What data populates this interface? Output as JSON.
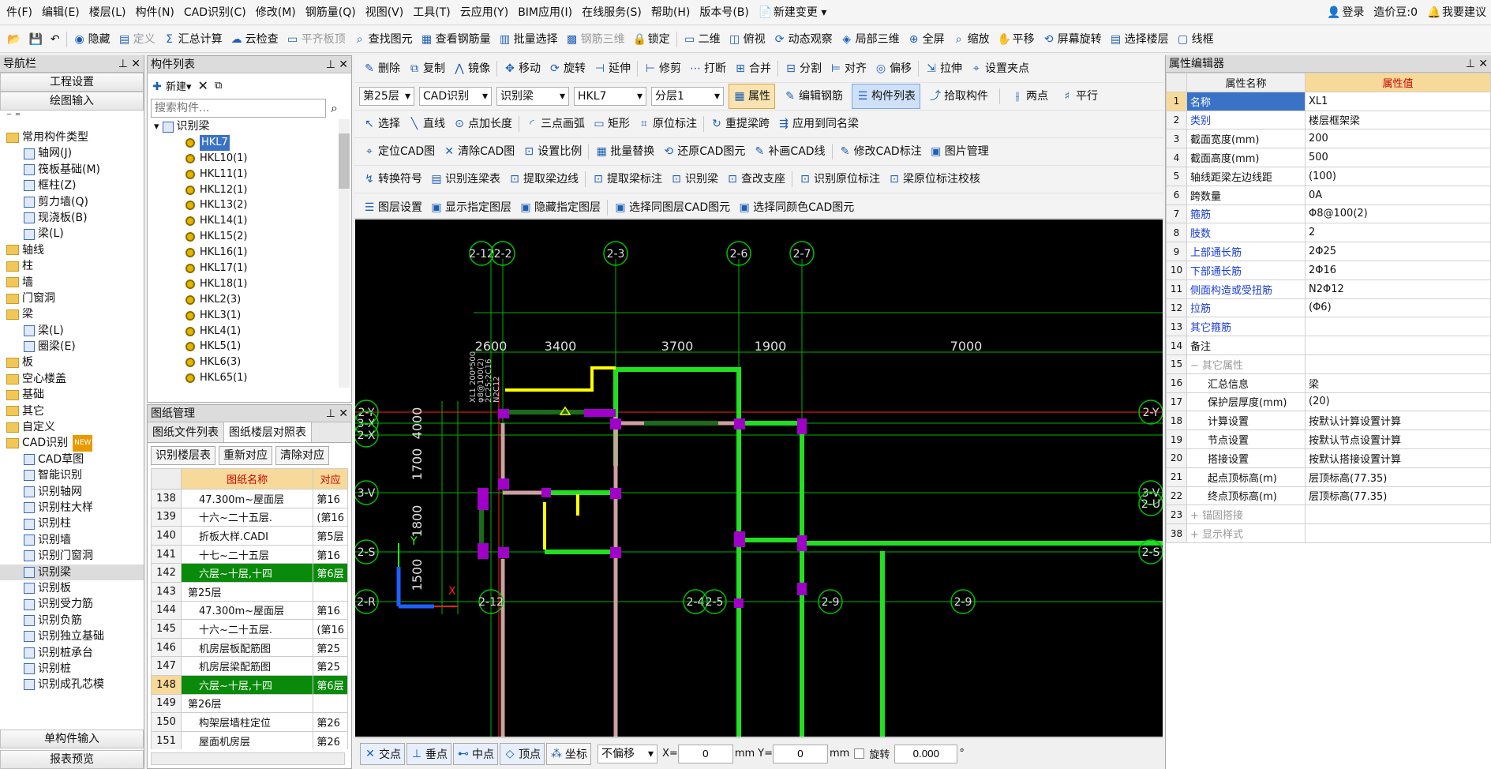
{
  "menubar": {
    "items": [
      "件(F)",
      "编辑(E)",
      "楼层(L)",
      "构件(N)",
      "CAD识别(C)",
      "修改(M)",
      "钢筋量(Q)",
      "视图(V)",
      "工具(T)",
      "云应用(Y)",
      "BIM应用(I)",
      "在线服务(S)",
      "帮助(H)",
      "版本号(B)"
    ],
    "new_change": "新建变更",
    "login": "登录",
    "price_beans": "造价豆:0",
    "suggest": "我要建议"
  },
  "toolbar1": {
    "items": [
      "隐藏",
      "定义",
      "汇总计算",
      "云检查",
      "平齐板顶",
      "查找图元",
      "查看钢筋量",
      "批量选择",
      "钢筋三维",
      "锁定"
    ],
    "view_items": [
      "二维",
      "俯视",
      "动态观察",
      "局部三维",
      "全屏",
      "缩放",
      "平移",
      "屏幕旋转",
      "选择楼层",
      "线框"
    ]
  },
  "nav": {
    "title": "导航栏",
    "btn_project": "工程设置",
    "btn_draw": "绘图输入",
    "btn_single": "单构件输入",
    "btn_report": "报表预览",
    "tree": [
      "常用构件类型",
      "轴网(J)",
      "筏板基础(M)",
      "框柱(Z)",
      "剪力墙(Q)",
      "现浇板(B)",
      "梁(L)",
      "轴线",
      "柱",
      "墙",
      "门窗洞",
      "梁",
      "梁(L)",
      "圈梁(E)",
      "板",
      "空心楼盖",
      "基础",
      "其它",
      "自定义",
      "CAD识别",
      "CAD草图",
      "智能识别",
      "识别轴网",
      "识别柱大样",
      "识别柱",
      "识别墙",
      "识别门窗洞",
      "识别梁",
      "识别板",
      "识别受力筋",
      "识别负筋",
      "识别独立基础",
      "识别桩承台",
      "识别桩",
      "识别成孔芯模"
    ],
    "new_badge": "NEW"
  },
  "components": {
    "title": "构件列表",
    "new": "新建",
    "search_placeholder": "搜索构件...",
    "group": "识别梁",
    "items": [
      "HKL7",
      "HKL10(1)",
      "HKL11(1)",
      "HKL12(1)",
      "HKL13(2)",
      "HKL14(1)",
      "HKL15(2)",
      "HKL16(1)",
      "HKL17(1)",
      "HKL18(1)",
      "HKL2(3)",
      "HKL3(1)",
      "HKL4(1)",
      "HKL5(1)",
      "HKL6(3)",
      "HKL65(1)"
    ]
  },
  "drawings": {
    "title": "图纸管理",
    "tabs": [
      "图纸文件列表",
      "图纸楼层对照表"
    ],
    "buttons": [
      "识别楼层表",
      "重新对应",
      "清除对应"
    ],
    "col_name": "图纸名称",
    "col_map": "对应",
    "rows": [
      [
        "138",
        "47.300m~屋面层",
        "第16"
      ],
      [
        "139",
        "十六~二十五层.",
        "(第16"
      ],
      [
        "140",
        "折板大样.CADI",
        "第5层"
      ],
      [
        "141",
        "十七~二十五层",
        "第16"
      ],
      [
        "142",
        "六层~十层,十四",
        "第6层"
      ],
      [
        "143",
        "第25层",
        ""
      ],
      [
        "144",
        "47.300m~屋面层",
        "第16"
      ],
      [
        "145",
        "十六~二十五层.",
        "(第16"
      ],
      [
        "146",
        "机房层板配筋图",
        "第25"
      ],
      [
        "147",
        "机房层梁配筋图",
        "第25"
      ],
      [
        "148",
        "六层~十层,十四",
        "第6层"
      ],
      [
        "149",
        "第26层",
        ""
      ],
      [
        "150",
        "构架层墙柱定位",
        "第26"
      ],
      [
        "151",
        "屋面机房层",
        "第26"
      ]
    ]
  },
  "ribbon": {
    "r1": [
      "删除",
      "复制",
      "镜像",
      "移动",
      "旋转",
      "延伸",
      "修剪",
      "打断",
      "合并",
      "分割",
      "对齐",
      "偏移",
      "拉伸",
      "设置夹点"
    ],
    "r2": {
      "floor": "第25层",
      "cad": "CAD识别",
      "beam": "识别梁",
      "comp": "HKL7",
      "layer": "分层1",
      "attr": "属性",
      "edit_rebar": "编辑钢筋",
      "comp_list": "构件列表",
      "pick": "拾取构件",
      "two_point": "两点",
      "parallel": "平行"
    },
    "r3": [
      "选择",
      "直线",
      "点加长度",
      "三点画弧",
      "矩形",
      "原位标注",
      "重提梁跨",
      "应用到同名梁"
    ],
    "r4": [
      "定位CAD图",
      "清除CAD图",
      "设置比例",
      "批量替换",
      "还原CAD图元",
      "补画CAD线",
      "修改CAD标注",
      "图片管理"
    ],
    "r5": [
      "转换符号",
      "识别连梁表",
      "提取梁边线",
      "提取梁标注",
      "识别梁",
      "查改支座",
      "识别原位标注",
      "梁原位标注校核"
    ],
    "r6": [
      "图层设置",
      "显示指定图层",
      "隐藏指定图层",
      "选择同图层CAD图元",
      "选择同颜色CAD图元"
    ]
  },
  "canvas": {
    "axes_top": [
      "2-12",
      "2-2",
      "2-3",
      "2-6",
      "2-7"
    ],
    "dims_top": [
      "2600",
      "3400",
      "3700",
      "1900",
      "7000"
    ],
    "axes_left": [
      "2-Y",
      "3-X",
      "2-X",
      "3-V",
      "2-S",
      "2-R"
    ],
    "axes_right": [
      "2-Y",
      "3-V",
      "2-U",
      "2-S"
    ],
    "dims_left": [
      "4000",
      "1700",
      "1800",
      "1500"
    ],
    "axes_bottom": [
      "2-12",
      "2-4",
      "2-5",
      "2-9",
      "2-9"
    ],
    "beam_label": [
      "XL1 200*500",
      "φ8@100(2)",
      "2C25;2C16",
      "N2C12"
    ],
    "ucs_y": "Y",
    "ucs_x": "X"
  },
  "status": {
    "items": [
      "交点",
      "垂点",
      "中点",
      "顶点",
      "坐标"
    ],
    "offset": "不偏移",
    "x_label": "X=",
    "x_val": "0",
    "unit": "mm",
    "y_label": "Y=",
    "y_val": "0",
    "rotate": "旋转",
    "rot_val": "0.000",
    "deg": "°"
  },
  "props": {
    "title": "属性编辑器",
    "col_name": "属性名称",
    "col_val": "属性值",
    "rows": [
      [
        "1",
        "名称",
        "XL1",
        "b"
      ],
      [
        "2",
        "类别",
        "楼层框架梁",
        "b"
      ],
      [
        "3",
        "截面宽度(mm)",
        "200",
        ""
      ],
      [
        "4",
        "截面高度(mm)",
        "500",
        ""
      ],
      [
        "5",
        "轴线距梁左边线距",
        "(100)",
        ""
      ],
      [
        "6",
        "跨数量",
        "0A",
        ""
      ],
      [
        "7",
        "箍筋",
        "Φ8@100(2)",
        "b"
      ],
      [
        "8",
        "肢数",
        "2",
        "b"
      ],
      [
        "9",
        "上部通长筋",
        "2Φ25",
        "b"
      ],
      [
        "10",
        "下部通长筋",
        "2Φ16",
        "b"
      ],
      [
        "11",
        "侧面构造或受扭筋",
        "N2Φ12",
        "b"
      ],
      [
        "12",
        "拉筋",
        "(Φ6)",
        "b"
      ],
      [
        "13",
        "其它箍筋",
        "",
        "b"
      ],
      [
        "14",
        "备注",
        "",
        ""
      ],
      [
        "15",
        "− 其它属性",
        "",
        "g"
      ],
      [
        "16",
        "汇总信息",
        "梁",
        "i"
      ],
      [
        "17",
        "保护层厚度(mm)",
        "(20)",
        "i"
      ],
      [
        "18",
        "计算设置",
        "按默认计算设置计算",
        "i"
      ],
      [
        "19",
        "节点设置",
        "按默认节点设置计算",
        "i"
      ],
      [
        "20",
        "搭接设置",
        "按默认搭接设置计算",
        "i"
      ],
      [
        "21",
        "起点顶标高(m)",
        "层顶标高(77.35)",
        "i"
      ],
      [
        "22",
        "终点顶标高(m)",
        "层顶标高(77.35)",
        "i"
      ],
      [
        "23",
        "+ 锚固搭接",
        "",
        "g"
      ],
      [
        "38",
        "+ 显示样式",
        "",
        "g"
      ]
    ]
  }
}
